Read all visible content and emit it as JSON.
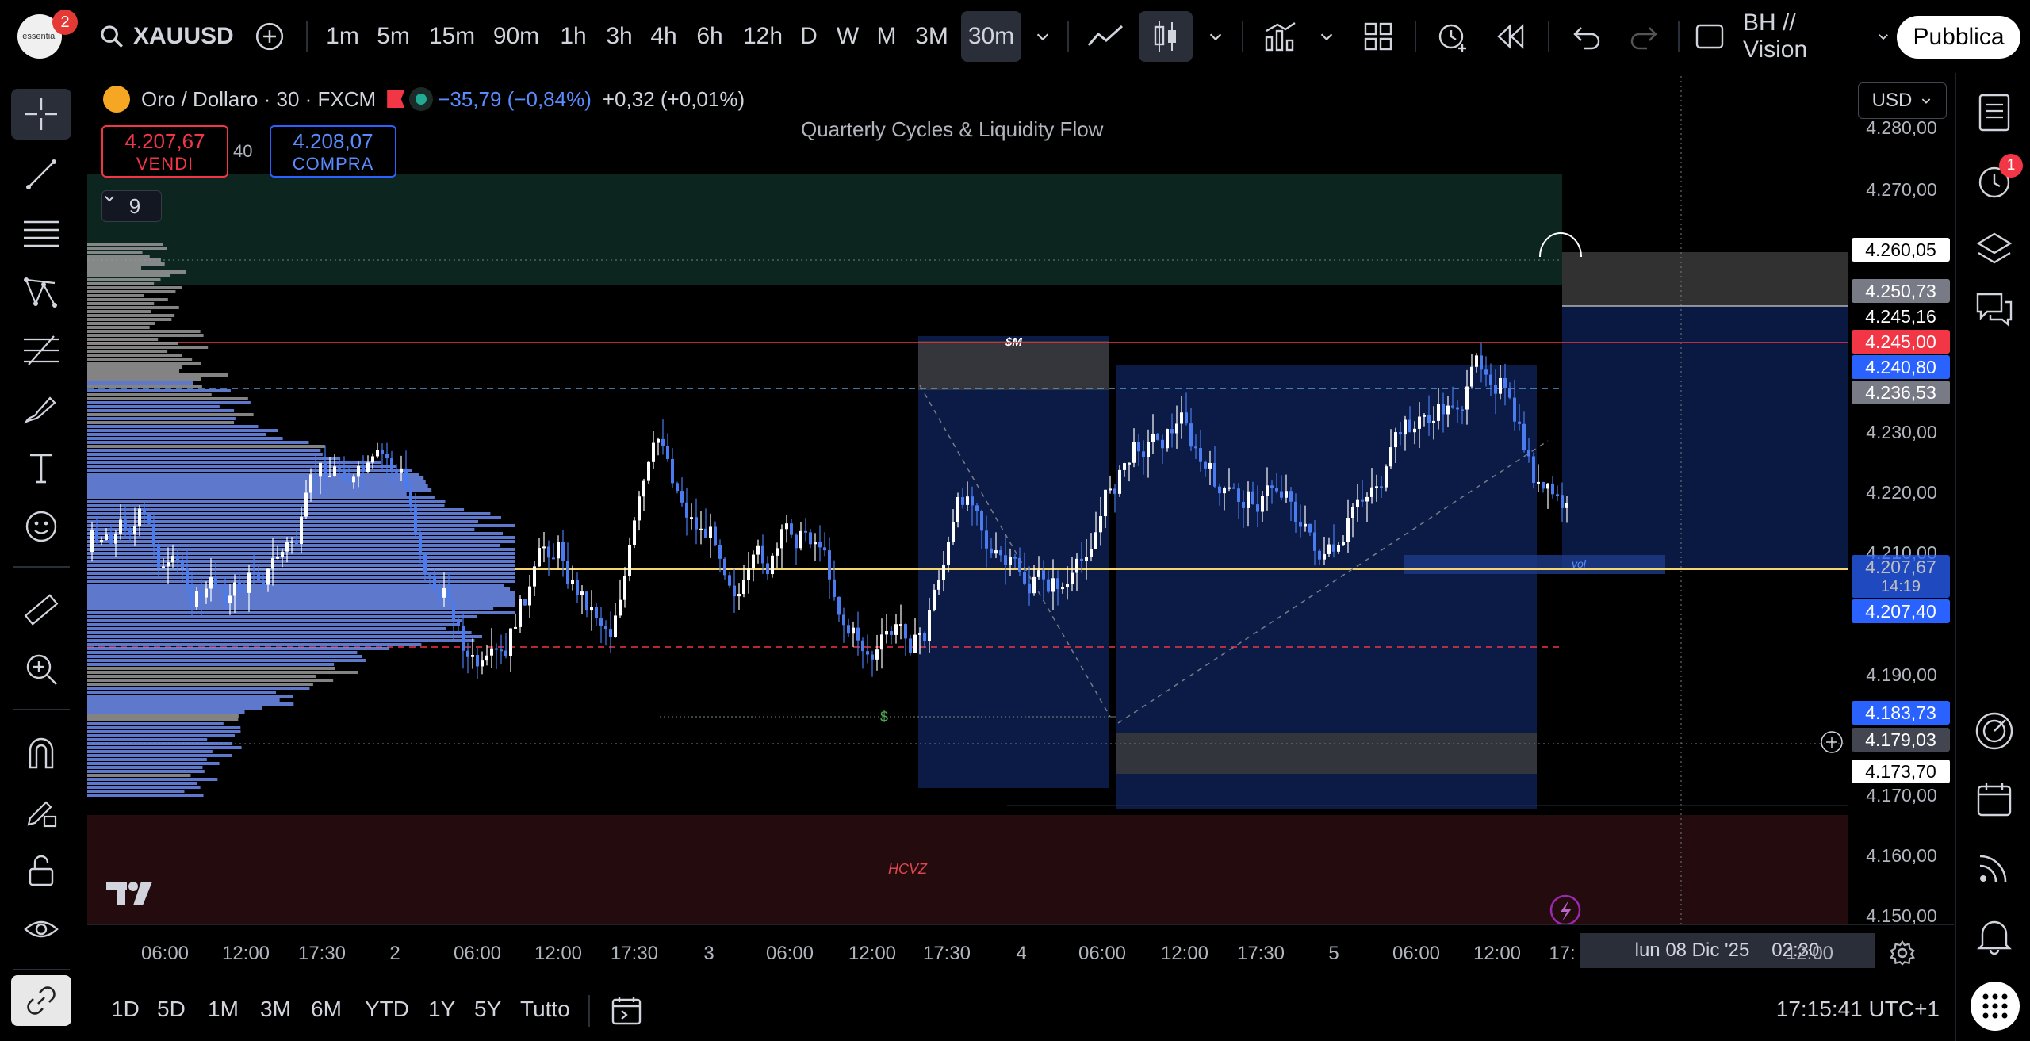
{
  "header": {
    "avatar_text": "essential",
    "avatar_badge": "2",
    "symbol": "XAUUSD",
    "timeframes": [
      "1m",
      "5m",
      "15m",
      "90m",
      "1h",
      "3h",
      "4h",
      "6h",
      "12h",
      "D",
      "W",
      "M",
      "3M",
      "30m"
    ],
    "active_timeframe": "30m",
    "layout_name": "BH // Vision",
    "publish_label": "Pubblica"
  },
  "legend": {
    "title": "Oro / Dollaro · 30 · FXCM",
    "change": "−35,79 (−0,84%)",
    "extra_change": "+0,32 (+0,01%)",
    "sell_price": "4.207,67",
    "sell_label": "VENDI",
    "spread": "40",
    "buy_price": "4.208,07",
    "buy_label": "COMPRA",
    "indicators_count": "9",
    "indicator_title": "Quarterly Cycles & Liquidity Flow"
  },
  "annotations": {
    "zone_top_label": "$M",
    "dollar_label": "$",
    "hcvz_label": "HCVZ",
    "vol_label": "vol"
  },
  "price_scale": {
    "currency": "USD",
    "labels": [
      "4.280,00",
      "4.270,00",
      "4.230,00",
      "4.220,00",
      "4.210,00",
      "4.190,00",
      "4.170,00",
      "4.160,00",
      "4.150,00"
    ],
    "tags": [
      {
        "text": "4.260,05",
        "bg": "#ffffff",
        "fg": "#000000"
      },
      {
        "text": "4.250,73",
        "bg": "#787b86",
        "fg": "#ffffff"
      },
      {
        "text": "4.245,16",
        "bg": "#000000",
        "fg": "#ffffff"
      },
      {
        "text": "4.245,00",
        "bg": "#f23645",
        "fg": "#ffffff"
      },
      {
        "text": "4.240,80",
        "bg": "#2962ff",
        "fg": "#ffffff"
      },
      {
        "text": "4.236,53",
        "bg": "#787b86",
        "fg": "#ffffff"
      },
      {
        "text": "4.207,40",
        "bg": "#2962ff",
        "fg": "#ffffff"
      },
      {
        "text": "4.183,73",
        "bg": "#2962ff",
        "fg": "#ffffff"
      },
      {
        "text": "4.179,03",
        "bg": "#434651",
        "fg": "#ffffff"
      },
      {
        "text": "4.173,70",
        "bg": "#ffffff",
        "fg": "#000000"
      }
    ],
    "last_price": "4.207,67",
    "countdown": "14:19"
  },
  "time_scale": {
    "labels": [
      "06:00",
      "12:00",
      "17:30",
      "2",
      "06:00",
      "12:00",
      "17:30",
      "3",
      "06:00",
      "12:00",
      "17:30",
      "4",
      "06:00",
      "12:00",
      "17:30",
      "5",
      "06:00",
      "12:00",
      "17:",
      "12:00"
    ],
    "crosshair_date": "lun 08 Dic '25",
    "crosshair_time": "02:30"
  },
  "bottom": {
    "ranges": [
      "1D",
      "5D",
      "1M",
      "3M",
      "6M",
      "YTD",
      "1Y",
      "5Y",
      "Tutto"
    ],
    "clock": "17:15:41 UTC+1"
  },
  "right_panel": {
    "alert_badge": "1"
  },
  "colors": {
    "bull": "#ffffff",
    "bear": "#4a7cf0",
    "zone_green": "#0d2a22",
    "zone_red": "#2a0d10",
    "accent_blue": "#2962ff",
    "accent_red": "#f23645"
  }
}
